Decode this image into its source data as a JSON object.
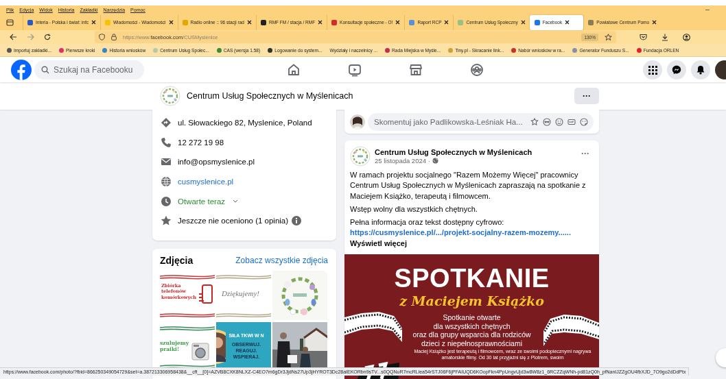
{
  "menu_bar": {
    "items": [
      "Plik",
      "Edycja",
      "Widok",
      "Historia",
      "Zakładki",
      "Narzędzia",
      "Pomoc"
    ]
  },
  "tabs": [
    {
      "label": "Interia - Polska i świat: infc",
      "selected": false,
      "color": "#2a5cbf"
    },
    {
      "label": "Wiadomości - Wiadomości",
      "selected": false,
      "color": "#f5c400"
    },
    {
      "label": "Radio online :: 96 stacji rad",
      "selected": false,
      "color": "#e0a800"
    },
    {
      "label": "RMF FM / stacja / RMF",
      "selected": false,
      "color": "#222222"
    },
    {
      "label": "Konsultacje społeczne - O!",
      "selected": false,
      "color": "#d8282f"
    },
    {
      "label": "Raport RCP",
      "selected": false,
      "color": "#5b8fd6"
    },
    {
      "label": "Centrum Usług Społeczny",
      "selected": false,
      "color": "#9bbf8a"
    },
    {
      "label": "Facebook",
      "selected": true,
      "color": "#1877f2"
    },
    {
      "label": "Powiatowe Centrum Pomo",
      "selected": false,
      "color": "#8a7a5a"
    }
  ],
  "address_bar": {
    "url_prefix": "https://www.",
    "url_domain": "facebook.com",
    "url_path": "/CUSMyslenice",
    "zoom": "130%"
  },
  "bookmarks": [
    {
      "label": "Importuj zakładki...",
      "color": "#555555"
    },
    {
      "label": "Pierwsze kroki",
      "color": "#d6336c"
    },
    {
      "label": "Historia wniosków",
      "color": "#3b82c4"
    },
    {
      "label": "Centrum Usług Społec...",
      "color": "#b9c9a6"
    },
    {
      "label": "CAS (wersja 1.58)",
      "color": "#3a8a3a"
    },
    {
      "label": "Logowanie do system...",
      "color": "#333333"
    },
    {
      "label": "Wydziały i naczelnicy ..."
    },
    {
      "label": "Rada Miejska w Myśle...",
      "color": "#c0304a"
    },
    {
      "label": "Tiny.pl - Skracanie link...",
      "color": "#c9a23a"
    },
    {
      "label": "Nabór wniosków w ra...",
      "color": "#c8302a"
    },
    {
      "label": "Generator Funduszu S...",
      "color": "#8890a8"
    },
    {
      "label": "Fundacja ORLEN",
      "color": "#e0202a"
    }
  ],
  "facebook_header": {
    "search_placeholder": "Szukaj na Facebooku"
  },
  "page_header": {
    "name": "Centrum Usług Społecznych w Myślenicach",
    "more": "···"
  },
  "intro": [
    {
      "kind": "address",
      "text": "ul. Słowackiego 82, Myslenice, Poland"
    },
    {
      "kind": "phone",
      "text": "12 272 19 98"
    },
    {
      "kind": "email",
      "text": "info@opsmyslenice.pl"
    },
    {
      "kind": "website",
      "text": "cusmyslenice.pl"
    },
    {
      "kind": "hours",
      "text": "Otwarte teraz"
    },
    {
      "kind": "rating",
      "text": "Jeszcze nie oceniono (1 opinia)"
    }
  ],
  "photos": {
    "title": "Zdjęcia",
    "see_all": "Zobacz wszystkie zdjęcia",
    "items": [
      {
        "kind": "phone-drive",
        "texts": [
          "Zbiórka telefonów komórkowych"
        ]
      },
      {
        "kind": "thanks",
        "texts": [
          "Dziękujemy!"
        ]
      },
      {
        "kind": "picture"
      },
      {
        "kind": "washer",
        "texts": [
          "szulujemy praiki!"
        ]
      },
      {
        "kind": "teal-banner",
        "texts": [
          "SIŁA TKWI W N",
          "OBSERWUJ. REAGUJ. WSPIERAJ."
        ]
      },
      {
        "kind": "picture"
      }
    ]
  },
  "comment_box": {
    "placeholder": "Skomentuj jako Padlikowska-Leśniak Ha..."
  },
  "post": {
    "author": "Centrum Usług Społecznych w Myślenicach",
    "date": "25 listopada 2024 ·",
    "more": "···",
    "paragraphs": [
      "W ramach projektu socjalnego \"Razem Możemy Więcej\" pracownicy Centrum Usług Społecznych w Myślenicach zapraszają na spotkanie z Maciejem Książko, terapeutą i filmowcem.",
      "Wstęp wolny dla wszystkich chętnych."
    ],
    "link_intro": "Pełna informacja oraz tekst dostępny cyfrowo:",
    "link": "https://cusmyslenice.pl/.../projekt-socjalny-razem-mozemy......",
    "see_more": "Wyświetl więcej",
    "flyer": {
      "title": "SPOTKANIE",
      "subtitle": "z Maciejem Książko",
      "lines": [
        "Spotkanie otwarte",
        "dla wszystkich chętnych",
        "oraz dla grupy wsparcia dla rodziców",
        "dzieci z niepełnosprawnościami"
      ],
      "footer": "Maciej Książko jest terapeutą i filmowcem, wraz ze swoimi podopiecznymi nagrywa amatorskie filmy. Od 30 lat przyjaźni się z Piotrem, swoim"
    }
  },
  "status_bar": {
    "url": "https://www.facebook.com/photo/?fbid=866250349054729&set=a.387213306958438&__cft__[0]=AZVB8CXK8NLXZ-C4EO7m6gDr3JjdNs27Up3jHYROT3Dc28aIEKORbn9sTV...s0QQNuR7mcRLlea54rSTJ06F6jPFAIUQD6KOopFkn4PpUngvUjd3w8W8z1_6RCZZqWNh-pd81zQ0h_pfNanIJZZgOU4fbXJD_7O9go2dDdPtx"
  }
}
